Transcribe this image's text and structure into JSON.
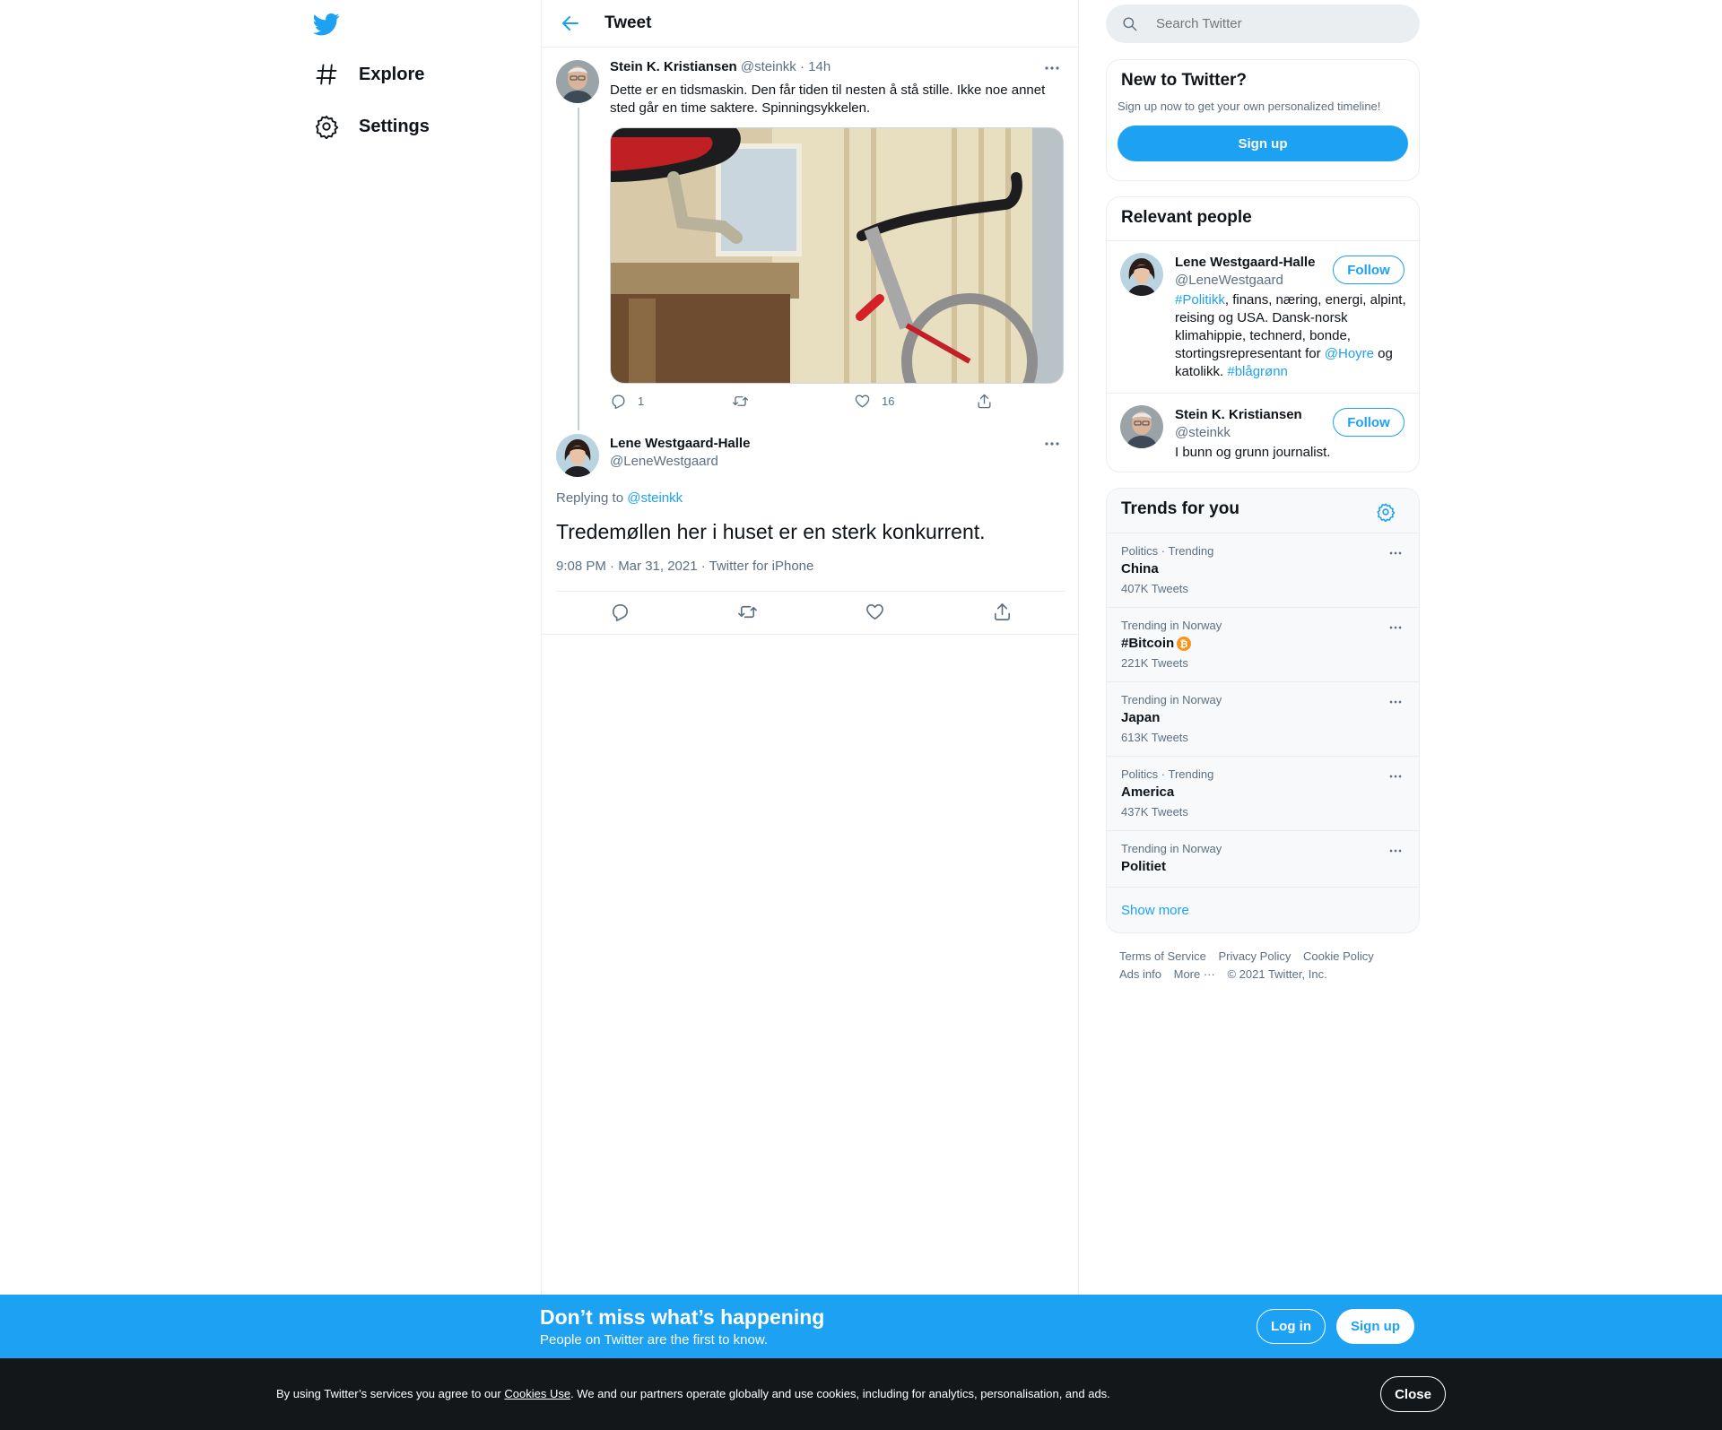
{
  "nav": {
    "items": [
      {
        "label": "Explore",
        "icon": "hashtag-icon"
      },
      {
        "label": "Settings",
        "icon": "gear-icon"
      }
    ]
  },
  "header": {
    "title": "Tweet"
  },
  "parent_tweet": {
    "name": "Stein K. Kristiansen",
    "handle": "@steinkk",
    "time": "· 14h",
    "text": "Dette er en tidsmaskin. Den får tiden til nesten å stå stille. Ikke noe annet sted går en time saktere. Spinningsykkelen.",
    "reply_count": "1",
    "like_count": "16"
  },
  "main_tweet": {
    "name": "Lene Westgaard-Halle",
    "handle": "@LeneWestgaard",
    "replying_prefix": "Replying to",
    "replying_to": "@steinkk",
    "text": "Tredemøllen her i huset er en sterk konkurrent.",
    "meta": "9:08 PM · Mar 31, 2021 · Twitter for iPhone"
  },
  "search": {
    "placeholder": "Search Twitter"
  },
  "new_to_twitter": {
    "title": "New to Twitter?",
    "subtitle": "Sign up now to get your own personalized timeline!",
    "button": "Sign up"
  },
  "relevant_people": {
    "title": "Relevant people",
    "people": [
      {
        "name": "Lene Westgaard-Halle",
        "handle": "@LeneWestgaard",
        "follow": "Follow",
        "bio_parts": [
          "#Politikk",
          ", finans, næring, energi, alpint, reising og USA. Dansk-norsk klimahippie, technerd, bonde, stortingsrepresentant for ",
          "@Hoyre",
          " og katolikk. ",
          "#blågrønn"
        ]
      },
      {
        "name": "Stein K. Kristiansen",
        "handle": "@steinkk",
        "follow": "Follow",
        "bio": "I bunn og grunn journalist."
      }
    ]
  },
  "trends": {
    "title": "Trends for you",
    "items": [
      {
        "context": "Politics · Trending",
        "name": "China",
        "count": "407K Tweets"
      },
      {
        "context": "Trending in Norway",
        "name": "#Bitcoin",
        "count": "221K Tweets"
      },
      {
        "context": "Trending in Norway",
        "name": "Japan",
        "count": "613K Tweets"
      },
      {
        "context": "Politics · Trending",
        "name": "America",
        "count": "437K Tweets"
      },
      {
        "context": "Trending in Norway",
        "name": "Politiet",
        "count": ""
      }
    ],
    "show_more": "Show more"
  },
  "footer": {
    "links": [
      "Terms of Service",
      "Privacy Policy",
      "Cookie Policy",
      "Ads info",
      "More ···"
    ],
    "copyright": "© 2021 Twitter, Inc."
  },
  "banner": {
    "title": "Don’t miss what’s happening",
    "subtitle": "People on Twitter are the first to know.",
    "login": "Log in",
    "signup": "Sign up"
  },
  "cookie": {
    "prefix": "By using Twitter’s services you agree to our ",
    "link": "Cookies Use",
    "suffix": ". We and our partners operate globally and use cookies, including for analytics, personalisation, and ads.",
    "close": "Close"
  },
  "colors": {
    "accent": "#1da1f2",
    "text": "#0f1419",
    "muted": "#5b7083",
    "bitcoin": "#f7931a"
  }
}
